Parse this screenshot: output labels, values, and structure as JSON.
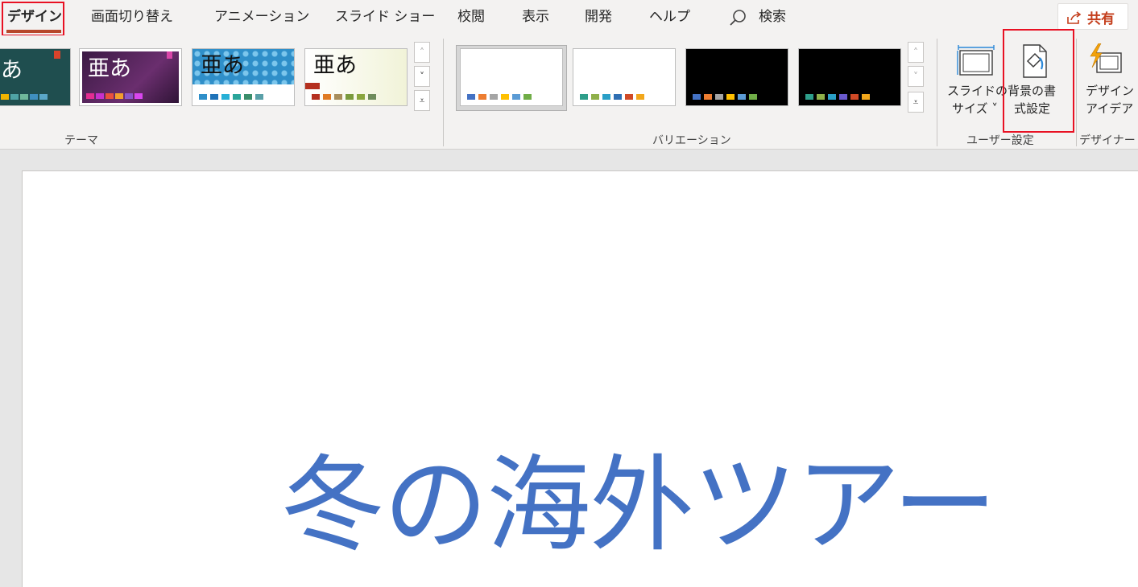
{
  "tabs": {
    "design": "デザイン",
    "transitions": "画面切り替え",
    "animations": "アニメーション",
    "slideshow": "スライド ショー",
    "review": "校閲",
    "view": "表示",
    "developer": "開発",
    "help": "ヘルプ",
    "search": "検索"
  },
  "share_label": "共有",
  "themes": {
    "group_label": "テーマ",
    "items": [
      {
        "title": "あ"
      },
      {
        "title": "亜あ"
      },
      {
        "title": "亜あ"
      },
      {
        "title": "亜あ"
      }
    ]
  },
  "variations": {
    "group_label": "バリエーション"
  },
  "customize": {
    "group_label": "ユーザー設定",
    "slide_size_line1": "スライドの",
    "slide_size_line2": "サイズ ˅",
    "format_bg_line1": "背景の書",
    "format_bg_line2": "式設定"
  },
  "designer": {
    "group_label": "デザイナー",
    "ideas_line1": "デザイン",
    "ideas_line2": "アイデア"
  },
  "slide": {
    "title": "冬の海外ツアー"
  },
  "colors": {
    "accent": "#b7472a",
    "highlight": "#e81123",
    "slide_title": "#4472c4"
  }
}
